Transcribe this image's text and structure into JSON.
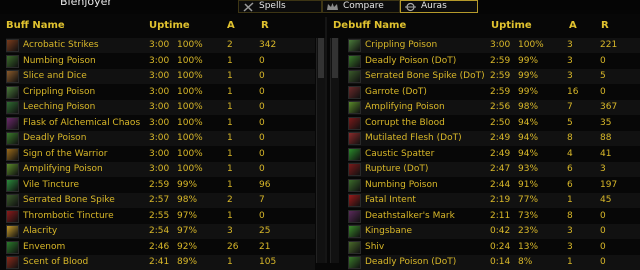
{
  "header": {
    "player_name": "Blenjoyer",
    "tabs": [
      {
        "label": "Spells",
        "icon": "spells-icon",
        "active": false
      },
      {
        "label": "Compare",
        "icon": "crown-icon",
        "active": false
      },
      {
        "label": "Auras",
        "icon": "auras-icon",
        "active": true
      }
    ]
  },
  "buffs": {
    "columns": {
      "name": "Buff Name",
      "uptime": "Uptime",
      "a": "A",
      "r": "R"
    },
    "rows": [
      {
        "name": "Acrobatic Strikes",
        "time": "3:00",
        "pct": "100%",
        "a": "2",
        "r": "342",
        "color": "#7a3b1b"
      },
      {
        "name": "Numbing Poison",
        "time": "3:00",
        "pct": "100%",
        "a": "1",
        "r": "0",
        "color": "#3b6b2a"
      },
      {
        "name": "Slice and Dice",
        "time": "3:00",
        "pct": "100%",
        "a": "1",
        "r": "0",
        "color": "#8a5a2a"
      },
      {
        "name": "Crippling Poison",
        "time": "3:00",
        "pct": "100%",
        "a": "1",
        "r": "0",
        "color": "#4a7a3a"
      },
      {
        "name": "Leeching Poison",
        "time": "3:00",
        "pct": "100%",
        "a": "1",
        "r": "0",
        "color": "#2f6a30"
      },
      {
        "name": "Flask of Alchemical Chaos",
        "time": "3:00",
        "pct": "100%",
        "a": "1",
        "r": "0",
        "color": "#6a2a6a"
      },
      {
        "name": "Deadly Poison",
        "time": "3:00",
        "pct": "100%",
        "a": "1",
        "r": "0",
        "color": "#3a7a2a"
      },
      {
        "name": "Sign of the Warrior",
        "time": "3:00",
        "pct": "100%",
        "a": "1",
        "r": "0",
        "color": "#9a6a1a"
      },
      {
        "name": "Amplifying Poison",
        "time": "3:00",
        "pct": "100%",
        "a": "1",
        "r": "0",
        "color": "#5a8a2a"
      },
      {
        "name": "Vile Tincture",
        "time": "2:59",
        "pct": "99%",
        "a": "1",
        "r": "96",
        "color": "#2a8a3a"
      },
      {
        "name": "Serrated Bone Spike",
        "time": "2:57",
        "pct": "98%",
        "a": "2",
        "r": "7",
        "color": "#3a5a2a"
      },
      {
        "name": "Thrombotic Tincture",
        "time": "2:55",
        "pct": "97%",
        "a": "1",
        "r": "0",
        "color": "#8a1a1a"
      },
      {
        "name": "Alacrity",
        "time": "2:54",
        "pct": "97%",
        "a": "3",
        "r": "25",
        "color": "#c49a2a"
      },
      {
        "name": "Envenom",
        "time": "2:46",
        "pct": "92%",
        "a": "26",
        "r": "21",
        "color": "#2a7a2a"
      },
      {
        "name": "Scent of Blood",
        "time": "2:41",
        "pct": "89%",
        "a": "1",
        "r": "105",
        "color": "#8a2a1a"
      }
    ]
  },
  "debuffs": {
    "columns": {
      "name": "Debuff Name",
      "uptime": "Uptime",
      "a": "A",
      "r": "R"
    },
    "rows": [
      {
        "name": "Crippling Poison",
        "time": "3:00",
        "pct": "100%",
        "a": "3",
        "r": "221",
        "color": "#4a7a3a"
      },
      {
        "name": "Deadly Poison (DoT)",
        "time": "2:59",
        "pct": "99%",
        "a": "3",
        "r": "0",
        "color": "#3a7a2a"
      },
      {
        "name": "Serrated Bone Spike (DoT)",
        "time": "2:59",
        "pct": "99%",
        "a": "3",
        "r": "5",
        "color": "#3a5a2a"
      },
      {
        "name": "Garrote (DoT)",
        "time": "2:59",
        "pct": "99%",
        "a": "16",
        "r": "0",
        "color": "#6a2a2a"
      },
      {
        "name": "Amplifying Poison",
        "time": "2:56",
        "pct": "98%",
        "a": "7",
        "r": "367",
        "color": "#5a8a2a"
      },
      {
        "name": "Corrupt the Blood",
        "time": "2:50",
        "pct": "94%",
        "a": "5",
        "r": "35",
        "color": "#7a1a1a"
      },
      {
        "name": "Mutilated Flesh (DoT)",
        "time": "2:49",
        "pct": "94%",
        "a": "8",
        "r": "88",
        "color": "#8a2a2a"
      },
      {
        "name": "Caustic Spatter",
        "time": "2:49",
        "pct": "94%",
        "a": "4",
        "r": "41",
        "color": "#2a8a2a"
      },
      {
        "name": "Rupture (DoT)",
        "time": "2:47",
        "pct": "93%",
        "a": "6",
        "r": "3",
        "color": "#7a1a1a"
      },
      {
        "name": "Numbing Poison",
        "time": "2:44",
        "pct": "91%",
        "a": "6",
        "r": "197",
        "color": "#3b6b2a"
      },
      {
        "name": "Fatal Intent",
        "time": "2:19",
        "pct": "77%",
        "a": "1",
        "r": "45",
        "color": "#9a1a1a"
      },
      {
        "name": "Deathstalker's Mark",
        "time": "2:11",
        "pct": "73%",
        "a": "8",
        "r": "0",
        "color": "#5a2a5a"
      },
      {
        "name": "Kingsbane",
        "time": "0:42",
        "pct": "23%",
        "a": "3",
        "r": "0",
        "color": "#3a8a2a"
      },
      {
        "name": "Shiv",
        "time": "0:24",
        "pct": "13%",
        "a": "3",
        "r": "0",
        "color": "#4a6a2a"
      },
      {
        "name": "Deadly Poison (DoT)",
        "time": "0:14",
        "pct": "8%",
        "a": "1",
        "r": "0",
        "color": "#3a7a2a"
      }
    ]
  }
}
